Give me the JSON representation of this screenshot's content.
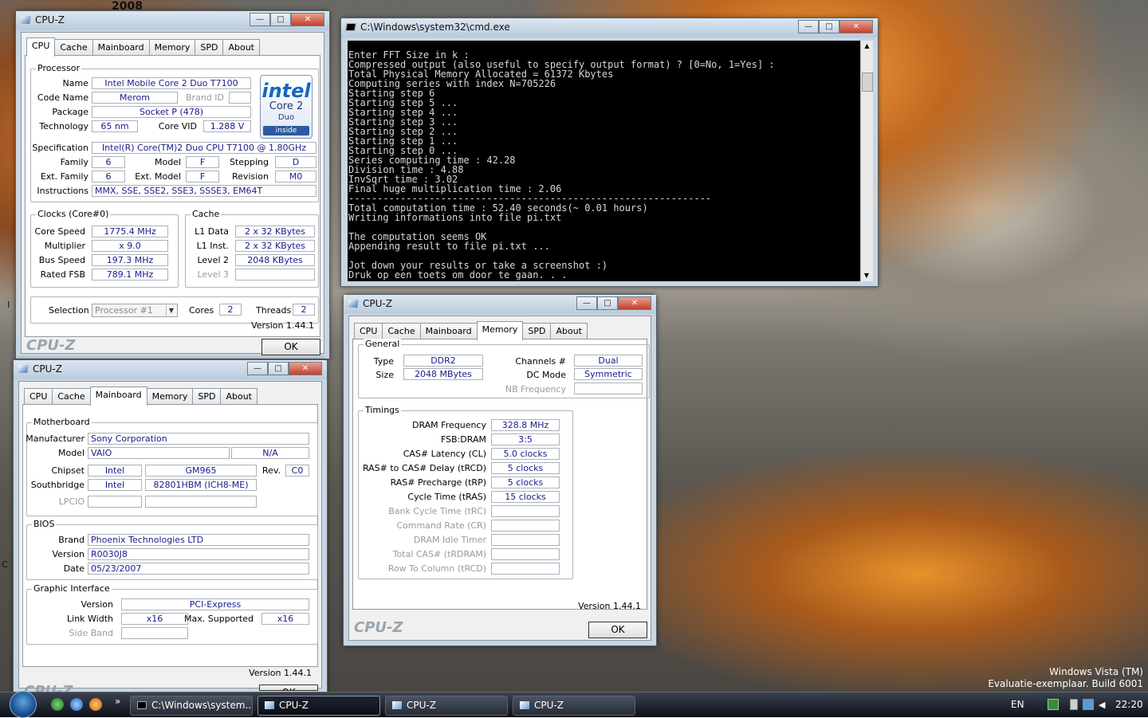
{
  "desktop": {
    "stray_text": "2008",
    "stray_left1": "I",
    "stray_left2": "C",
    "watermark_line1": "Windows Vista (TM)",
    "watermark_line2": "Evaluatie-exemplaar. Build 6001"
  },
  "cpuz_common": {
    "tabs": [
      "CPU",
      "Cache",
      "Mainboard",
      "Memory",
      "SPD",
      "About"
    ],
    "version": "Version 1.44.1",
    "logo": "CPU-Z",
    "ok": "OK",
    "title": "CPU-Z",
    "min": "—",
    "max": "□",
    "close": "✕"
  },
  "cpu": {
    "processor_title": "Processor",
    "name_label": "Name",
    "name": "Intel Mobile Core 2 Duo T7100",
    "codename_label": "Code Name",
    "codename": "Merom",
    "brandid_label": "Brand ID",
    "brandid": "",
    "package_label": "Package",
    "package": "Socket P (478)",
    "technology_label": "Technology",
    "technology": "65 nm",
    "corevid_label": "Core VID",
    "corevid": "1.288 V",
    "spec_label": "Specification",
    "spec": "Intel(R) Core(TM)2 Duo CPU     T7100  @ 1.80GHz",
    "family_label": "Family",
    "family": "6",
    "model_label": "Model",
    "model": "F",
    "stepping_label": "Stepping",
    "stepping": "D",
    "extfamily_label": "Ext. Family",
    "extfamily": "6",
    "extmodel_label": "Ext. Model",
    "extmodel": "F",
    "revision_label": "Revision",
    "revision": "M0",
    "instr_label": "Instructions",
    "instructions": "MMX, SSE, SSE2, SSE3, SSSE3, EM64T",
    "clocks_title": "Clocks (Core#0)",
    "corespeed_label": "Core Speed",
    "corespeed": "1775.4 MHz",
    "multiplier_label": "Multiplier",
    "multiplier": "x 9.0",
    "busspeed_label": "Bus Speed",
    "busspeed": "197.3 MHz",
    "ratedfsb_label": "Rated FSB",
    "ratedfsb": "789.1 MHz",
    "cache_title": "Cache",
    "l1d_label": "L1 Data",
    "l1d": "2 x 32 KBytes",
    "l1i_label": "L1 Inst.",
    "l1i": "2 x 32 KBytes",
    "l2_label": "Level 2",
    "l2": "2048 KBytes",
    "l3_label": "Level 3",
    "l3": "",
    "selection_label": "Selection",
    "selection": "Processor #1",
    "cores_label": "Cores",
    "cores": "2",
    "threads_label": "Threads",
    "threads": "2",
    "intel_logo": {
      "brand": "intel",
      "line2": "Core 2",
      "line3": "Duo",
      "line4": "inside"
    }
  },
  "mainboard": {
    "mb_title": "Motherboard",
    "manufacturer_label": "Manufacturer",
    "manufacturer": "Sony Corporation",
    "model_label": "Model",
    "model": "VAIO",
    "model2": "N/A",
    "chipset_label": "Chipset",
    "chipset_vendor": "Intel",
    "chipset": "GM965",
    "rev_label": "Rev.",
    "rev": "C0",
    "southbridge_label": "Southbridge",
    "sb_vendor": "Intel",
    "southbridge": "82801HBM (ICH8-ME)",
    "lpcio_label": "LPCIO",
    "bios_title": "BIOS",
    "brand_label": "Brand",
    "brand": "Phoenix Technologies LTD",
    "version_label": "Version",
    "version": "R0030J8",
    "date_label": "Date",
    "date": "05/23/2007",
    "gi_title": "Graphic Interface",
    "gi_version_label": "Version",
    "gi_version": "PCI-Express",
    "linkwidth_label": "Link Width",
    "linkwidth": "x16",
    "maxsup_label": "Max. Supported",
    "maxsup": "x16",
    "sideband_label": "Side Band"
  },
  "memory": {
    "general_title": "General",
    "type_label": "Type",
    "type": "DDR2",
    "size_label": "Size",
    "size": "2048 MBytes",
    "channels_label": "Channels #",
    "channels": "Dual",
    "dcmode_label": "DC Mode",
    "dcmode": "Symmetric",
    "nbfreq_label": "NB Frequency",
    "timings_title": "Timings",
    "timings": [
      {
        "label": "DRAM Frequency",
        "value": "328.8 MHz",
        "enabled": true
      },
      {
        "label": "FSB:DRAM",
        "value": "3:5",
        "enabled": true
      },
      {
        "label": "CAS# Latency (CL)",
        "value": "5.0 clocks",
        "enabled": true
      },
      {
        "label": "RAS# to CAS# Delay (tRCD)",
        "value": "5 clocks",
        "enabled": true
      },
      {
        "label": "RAS# Precharge (tRP)",
        "value": "5 clocks",
        "enabled": true
      },
      {
        "label": "Cycle Time (tRAS)",
        "value": "15 clocks",
        "enabled": true
      },
      {
        "label": "Bank Cycle Time (tRC)",
        "value": "",
        "enabled": false
      },
      {
        "label": "Command Rate (CR)",
        "value": "",
        "enabled": false
      },
      {
        "label": "DRAM Idle Timer",
        "value": "",
        "enabled": false
      },
      {
        "label": "Total CAS# (tRDRAM)",
        "value": "",
        "enabled": false
      },
      {
        "label": "Row To Column (tRCD)",
        "value": "",
        "enabled": false
      }
    ]
  },
  "cmd": {
    "title": "C:\\Windows\\system32\\cmd.exe",
    "output": "Enter FFT Size in k :\nCompressed output (also useful to specify output format) ? [0=No, 1=Yes] :\nTotal Physical Memory Allocated = 61372 Kbytes\nComputing series with index N=705226\nStarting step 6\nStarting step 5 ...\nStarting step 4 ...\nStarting step 3 ...\nStarting step 2 ...\nStarting step 1 ...\nStarting step 0 ...\nSeries computing time : 42.28\nDivision time : 4.88\nInvSqrt time : 3.02\nFinal huge multiplication time : 2.06\n---------------------------------------------------------------\nTotal computation time : 52.40 seconds(~ 0.01 hours)\nWriting informations into file pi.txt\n\nThe computation seems OK\nAppending result to file pi.txt ...\n\nJot down your results or take a screenshot :)\nDruk op een toets om door te gaan. . ."
  },
  "taskbar": {
    "tasks": [
      "C:\\Windows\\system...",
      "CPU-Z",
      "CPU-Z",
      "CPU-Z"
    ],
    "quicklaunch_more": "»",
    "lang": "EN",
    "clock": "22:20"
  }
}
